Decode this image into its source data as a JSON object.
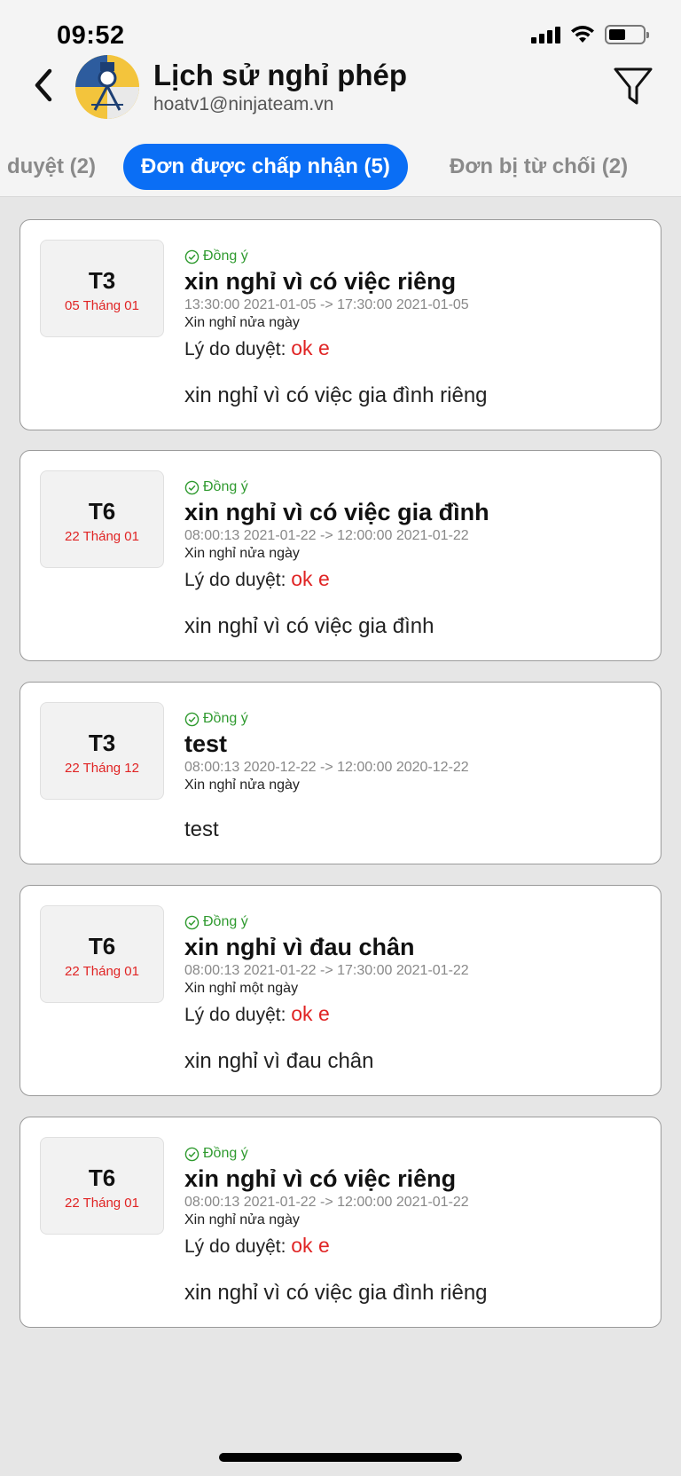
{
  "status_bar": {
    "time": "09:52"
  },
  "header": {
    "title": "Lịch sử nghỉ phép",
    "email": "hoatv1@ninjateam.vn"
  },
  "tabs": [
    {
      "label": "duyệt (2)",
      "active": false
    },
    {
      "label": "Đơn được chấp nhận (5)",
      "active": true
    },
    {
      "label": "Đơn bị từ chối (2)",
      "active": false
    }
  ],
  "requests": [
    {
      "day": "T3",
      "date": "05 Tháng 01",
      "status": "Đồng ý",
      "title": "xin nghỉ vì có việc riêng",
      "time": "13:30:00 2021-01-05 -> 17:30:00 2021-01-05",
      "type": "Xin nghỉ nửa ngày",
      "approval_label": "Lý do duyệt:",
      "approval_reason": "ok e",
      "reason": "xin nghỉ vì có việc gia đình riêng"
    },
    {
      "day": "T6",
      "date": "22 Tháng 01",
      "status": "Đồng ý",
      "title": "xin nghỉ vì có việc gia đình",
      "time": "08:00:13 2021-01-22 -> 12:00:00 2021-01-22",
      "type": "Xin nghỉ nửa ngày",
      "approval_label": "Lý do duyệt:",
      "approval_reason": "ok e",
      "reason": "xin nghỉ vì có việc gia đình"
    },
    {
      "day": "T3",
      "date": "22 Tháng 12",
      "status": "Đồng ý",
      "title": "test",
      "time": "08:00:13 2020-12-22 -> 12:00:00 2020-12-22",
      "type": "Xin nghỉ nửa ngày",
      "reason": "test"
    },
    {
      "day": "T6",
      "date": "22 Tháng 01",
      "status": "Đồng ý",
      "title": "xin nghỉ vì đau chân",
      "time": "08:00:13 2021-01-22 -> 17:30:00 2021-01-22",
      "type": "Xin nghỉ một ngày",
      "approval_label": "Lý do duyệt:",
      "approval_reason": "ok e",
      "reason": "xin nghỉ vì đau chân"
    },
    {
      "day": "T6",
      "date": "22 Tháng 01",
      "status": "Đồng ý",
      "title": "xin nghỉ vì có việc riêng",
      "time": "08:00:13 2021-01-22 -> 12:00:00 2021-01-22",
      "type": "Xin nghỉ nửa ngày",
      "approval_label": "Lý do duyệt:",
      "approval_reason": "ok e",
      "reason": "xin nghỉ vì có việc gia đình riêng"
    }
  ],
  "colors": {
    "accent": "#0a6ef5",
    "approved_green": "#2f9a2f",
    "date_red": "#e02424",
    "avatar_yellow": "#f3c43c"
  },
  "icons": [
    "signal-icon",
    "wifi-icon",
    "battery-icon",
    "back-chevron-icon",
    "filter-icon",
    "check-circle-icon"
  ]
}
